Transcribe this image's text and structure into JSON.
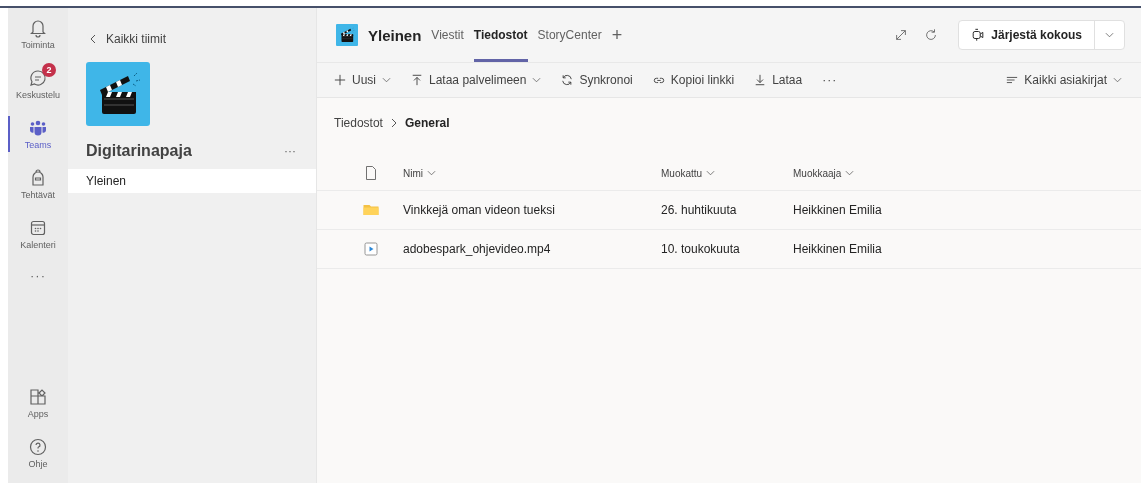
{
  "app_bar": {
    "items": [
      {
        "label": "Toiminta",
        "kind": "bell",
        "selected": false
      },
      {
        "label": "Keskustelu",
        "kind": "chat",
        "selected": false,
        "badge": "2"
      },
      {
        "label": "Teams",
        "kind": "teams",
        "selected": true
      },
      {
        "label": "Tehtävät",
        "kind": "backpack",
        "selected": false
      },
      {
        "label": "Kalenteri",
        "kind": "calendar",
        "selected": false
      }
    ],
    "more": "···",
    "bottom_items": [
      {
        "label": "Apps",
        "kind": "apps",
        "selected": false
      },
      {
        "label": "Ohje",
        "kind": "help",
        "selected": false
      }
    ]
  },
  "team_panel": {
    "back_link": "Kaikki tiimit",
    "team_name": "Digitarinapaja",
    "more": "···",
    "channels": [
      {
        "label": "Yleinen",
        "selected": true
      }
    ]
  },
  "header": {
    "channel": "Yleinen",
    "tabs": [
      {
        "label": "Viestit",
        "selected": false
      },
      {
        "label": "Tiedostot",
        "selected": true
      },
      {
        "label": "StoryCenter",
        "selected": false
      }
    ],
    "add_tab": "+",
    "meeting_button": "Järjestä kokous"
  },
  "toolbar": {
    "items": [
      {
        "label": "Uusi",
        "kind": "plus",
        "dropdown": true
      },
      {
        "label": "Lataa palvelimeen",
        "kind": "upload",
        "dropdown": true
      },
      {
        "label": "Synkronoi",
        "kind": "sync",
        "dropdown": false
      },
      {
        "label": "Kopioi linkki",
        "kind": "link",
        "dropdown": false
      },
      {
        "label": "Lataa",
        "kind": "download",
        "dropdown": false
      }
    ],
    "overflow": "···",
    "view": "Kaikki asiakirjat"
  },
  "breadcrumb": [
    {
      "label": "Tiedostot",
      "current": false
    },
    {
      "label": "General",
      "current": true
    }
  ],
  "table": {
    "columns": [
      "Nimi",
      "Muokattu",
      "Muokkaaja"
    ],
    "rows": [
      {
        "kind": "folder",
        "name": "Vinkkejä oman videon tueksi",
        "modified": "26. huhtikuuta",
        "modified_by": "Heikkinen Emilia"
      },
      {
        "kind": "video",
        "name": "adobespark_ohjevideo.mp4",
        "modified": "10. toukokuuta",
        "modified_by": "Heikkinen Emilia"
      }
    ]
  }
}
